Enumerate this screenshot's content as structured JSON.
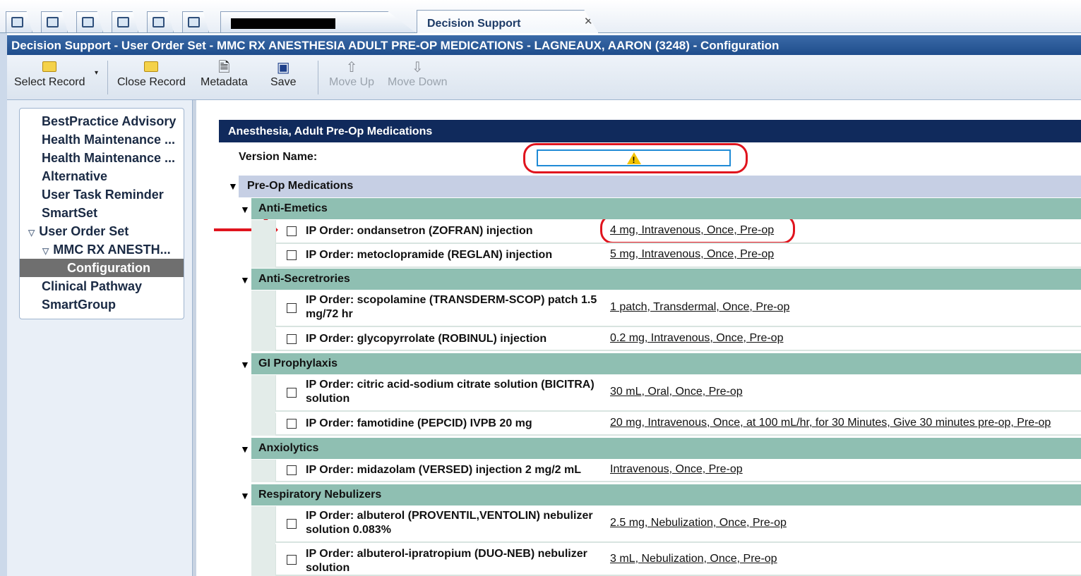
{
  "tabs": {
    "icons": [
      "home-icon",
      "computer-icon",
      "chart-icon",
      "clipboard-icon",
      "report-icon",
      "mail-icon"
    ],
    "active_tab": "Decision Support",
    "close_glyph": "✕"
  },
  "window": {
    "title": "Decision Support - User Order Set - MMC RX ANESTHESIA ADULT PRE-OP MEDICATIONS - LAGNEAUX, AARON (3248) - Configuration"
  },
  "toolbar": {
    "select_record": "Select Record",
    "close_record": "Close Record",
    "metadata": "Metadata",
    "save": "Save",
    "move_up": "Move Up",
    "move_down": "Move Down"
  },
  "nav": {
    "items": [
      "BestPractice Advisory",
      "Health Maintenance ...",
      "Health Maintenance ...",
      "Alternative",
      "User Task Reminder",
      "SmartSet",
      "User Order Set",
      "MMC RX ANESTH...",
      "Configuration",
      "Clinical Pathway",
      "SmartGroup"
    ]
  },
  "content": {
    "header": "Anesthesia, Adult Pre-Op Medications",
    "version_label": "Version Name:",
    "version_value": "",
    "section": "Pre-Op Medications",
    "groups": [
      {
        "name": "Anti-Emetics",
        "orders": [
          {
            "name": "IP Order: ondansetron (ZOFRAN) injection",
            "sig": "4 mg, Intravenous, Once, Pre-op"
          },
          {
            "name": "IP Order: metoclopramide (REGLAN) injection",
            "sig": "5 mg, Intravenous, Once, Pre-op"
          }
        ]
      },
      {
        "name": "Anti-Secretrories",
        "orders": [
          {
            "name": "IP Order: scopolamine (TRANSDERM-SCOP) patch 1.5 mg/72 hr",
            "sig": "1 patch, Transdermal, Once, Pre-op"
          },
          {
            "name": "IP Order: glycopyrrolate (ROBINUL) injection",
            "sig": "0.2 mg, Intravenous, Once, Pre-op"
          }
        ]
      },
      {
        "name": "GI Prophylaxis",
        "orders": [
          {
            "name": "IP Order: citric acid-sodium citrate solution (BICITRA) solution",
            "sig": "30 mL, Oral, Once, Pre-op"
          },
          {
            "name": "IP Order: famotidine (PEPCID) IVPB 20 mg",
            "sig": "20 mg, Intravenous, Once, at 100 mL/hr, for 30 Minutes, Give 30 minutes pre-op, Pre-op"
          }
        ]
      },
      {
        "name": "Anxiolytics",
        "orders": [
          {
            "name": "IP Order: midazolam (VERSED) injection  2 mg/2 mL",
            "sig": "Intravenous, Once, Pre-op"
          }
        ]
      },
      {
        "name": "Respiratory Nebulizers",
        "orders": [
          {
            "name": "IP Order: albuterol (PROVENTIL,VENTOLIN) nebulizer solution  0.083%",
            "sig": "2.5 mg, Nebulization, Once, Pre-op"
          },
          {
            "name": "IP Order: albuterol-ipratropium (DUO-NEB) nebulizer solution",
            "sig": "3 mL, Nebulization, Once, Pre-op"
          }
        ]
      }
    ]
  },
  "colors": {
    "header_navy": "#102a5c",
    "section_lavender": "#c6cfe4",
    "group_teal": "#8fbfb2",
    "annotation_red": "#e0141e"
  }
}
